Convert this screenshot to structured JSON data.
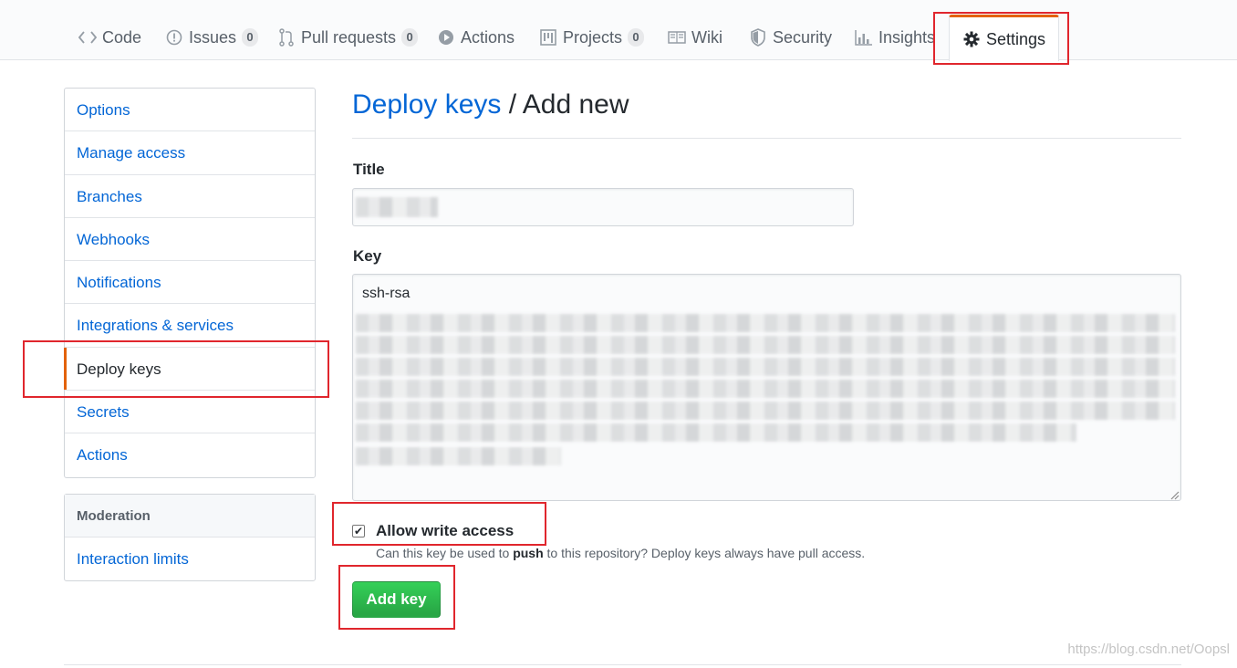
{
  "repo_nav": {
    "tabs": [
      {
        "label": "Code",
        "icon": "code-icon"
      },
      {
        "label": "Issues",
        "icon": "issue-icon",
        "count": "0"
      },
      {
        "label": "Pull requests",
        "icon": "pull-request-icon",
        "count": "0"
      },
      {
        "label": "Actions",
        "icon": "play-icon"
      },
      {
        "label": "Projects",
        "icon": "project-icon",
        "count": "0"
      },
      {
        "label": "Wiki",
        "icon": "book-icon"
      },
      {
        "label": "Security",
        "icon": "shield-icon"
      },
      {
        "label": "Insights",
        "icon": "graph-icon"
      },
      {
        "label": "Settings",
        "icon": "gear-icon",
        "selected": true
      }
    ]
  },
  "sidebar": {
    "items": [
      {
        "label": "Options"
      },
      {
        "label": "Manage access"
      },
      {
        "label": "Branches"
      },
      {
        "label": "Webhooks"
      },
      {
        "label": "Notifications"
      },
      {
        "label": "Integrations & services"
      },
      {
        "label": "Deploy keys",
        "selected": true
      },
      {
        "label": "Secrets"
      },
      {
        "label": "Actions"
      }
    ],
    "moderation": {
      "heading": "Moderation",
      "items": [
        {
          "label": "Interaction limits"
        }
      ]
    }
  },
  "main": {
    "heading_link": "Deploy keys",
    "heading_sep": "/",
    "heading_rest": "Add new",
    "title_label": "Title",
    "key_label": "Key",
    "key_prefix": "ssh-rsa",
    "allow_write_label": "Allow write access",
    "allow_write_checked": true,
    "note_before": "Can this key be used to ",
    "note_bold": "push",
    "note_after": " to this repository? Deploy keys always have pull access.",
    "add_button": "Add key"
  },
  "watermark": "https://blog.csdn.net/Oopsl",
  "colors": {
    "accent": "#e36209",
    "link": "#0366d6",
    "highlight_box": "#e0262d",
    "button_green": "#28a745"
  }
}
